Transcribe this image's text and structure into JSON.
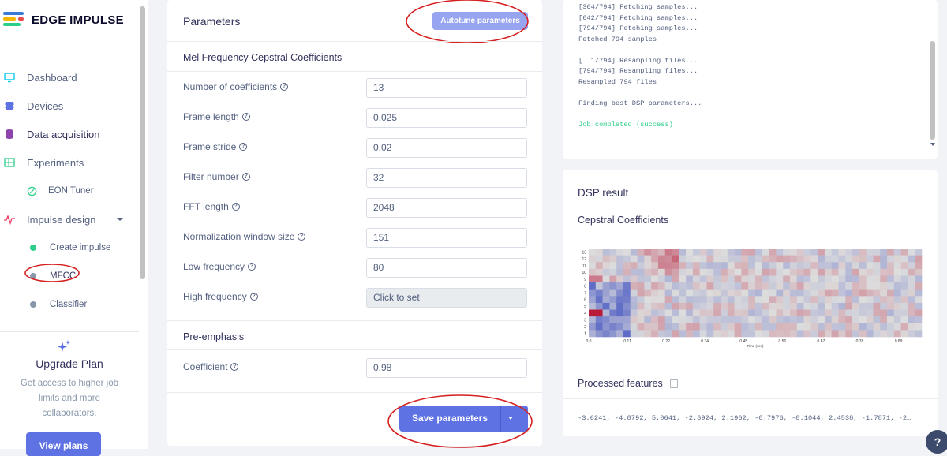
{
  "brand": {
    "name": "EDGE IMPULSE",
    "colors": [
      "#3a7bd5",
      "#f5b700",
      "#e84a4a",
      "#2dce89"
    ]
  },
  "sidebar": {
    "items": [
      {
        "label": "Dashboard",
        "icon": "monitor-icon"
      },
      {
        "label": "Devices",
        "icon": "chip-icon"
      },
      {
        "label": "Data acquisition",
        "icon": "database-icon"
      },
      {
        "label": "Experiments",
        "icon": "table-icon"
      },
      {
        "label": "EON Tuner",
        "icon": "eon-icon",
        "sub": true
      },
      {
        "label": "Impulse design",
        "icon": "pulse-icon",
        "has_caret": true
      },
      {
        "label": "Create impulse",
        "sub": true,
        "dot_color": "#2dce89"
      },
      {
        "label": "MFCC",
        "sub": true,
        "dot_color": "#8898aa"
      },
      {
        "label": "Classifier",
        "sub": true,
        "dot_color": "#8898aa"
      }
    ],
    "upgrade": {
      "title": "Upgrade Plan",
      "description": "Get access to higher job limits and more collaborators.",
      "button": "View plans"
    }
  },
  "parameters": {
    "title": "Parameters",
    "autotune_label": "Autotune parameters",
    "mfcc_heading": "Mel Frequency Cepstral Coefficients",
    "fields": [
      {
        "label": "Number of coefficients",
        "value": "13"
      },
      {
        "label": "Frame length",
        "value": "0.025"
      },
      {
        "label": "Frame stride",
        "value": "0.02"
      },
      {
        "label": "Filter number",
        "value": "32"
      },
      {
        "label": "FFT length",
        "value": "2048"
      },
      {
        "label": "Normalization window size",
        "value": "151"
      },
      {
        "label": "Low frequency",
        "value": "80"
      },
      {
        "label": "High frequency",
        "value": "Click to set",
        "disabled": true
      }
    ],
    "preemphasis_heading": "Pre-emphasis",
    "coefficient_label": "Coefficient",
    "coefficient_value": "0.98",
    "save_label": "Save parameters"
  },
  "log": {
    "lines": [
      "[364/794] Fetching samples...",
      "[642/794] Fetching samples...",
      "[794/794] Fetching samples...",
      "Fetched 794 samples",
      "",
      "[  1/794] Resampling files...",
      "[794/794] Resampling files...",
      "Resampled 794 files",
      "",
      "Finding best DSP parameters...",
      "",
      "Job completed (success)"
    ]
  },
  "dsp": {
    "title": "DSP result",
    "cepstral_title": "Cepstral Coefficients",
    "y_ticks": [
      "13",
      "12",
      "11",
      "10",
      "9",
      "8",
      "7",
      "6",
      "5",
      "4",
      "3",
      "2",
      "1"
    ],
    "x_ticks": [
      "0.0",
      "0.11",
      "0.22",
      "0.34",
      "0.45",
      "0.56",
      "0.67",
      "0.78",
      "0.89"
    ],
    "x_label": "Time (sec)",
    "processed_title": "Processed features",
    "features": "-3.6241, -4.0792, 5.0641, -2.6924, 2.1962, -0.7976, -0.1044, 2.4538, -1.7871, -2…"
  },
  "help_label": "?"
}
